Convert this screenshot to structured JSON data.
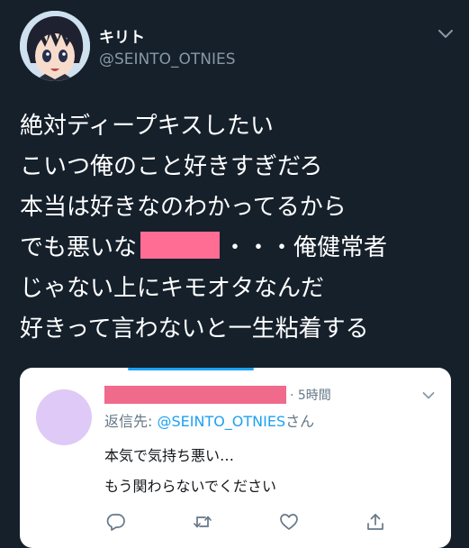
{
  "tweet": {
    "display_name": "キリト",
    "handle": "@SEINTO_OTNIES",
    "lines": [
      "絶対ディープキスしたい",
      "こいつ俺のこと好きすぎだろ",
      "本当は好きなのわかってるから",
      "でも悪いな",
      "・・・俺健常者",
      "じゃない上にキモオタなんだ",
      "好きって言わないと一生粘着する"
    ]
  },
  "reply": {
    "time": "· 5時間",
    "reply_to_prefix": "返信先: ",
    "reply_to_handle": "@SEINTO_OTNIES",
    "reply_to_suffix": "さん",
    "line1": "本気で気持ち悪い…",
    "line2": "もう関わらないでください"
  },
  "icons": {
    "menu": "chevron-down-icon",
    "reply": "reply-icon",
    "retweet": "retweet-icon",
    "like": "heart-icon",
    "share": "share-icon"
  },
  "colors": {
    "background": "#15202b",
    "accent": "#1da1f2",
    "redaction": "#ff6d94",
    "reply_avatar": "#dfc9f6"
  }
}
